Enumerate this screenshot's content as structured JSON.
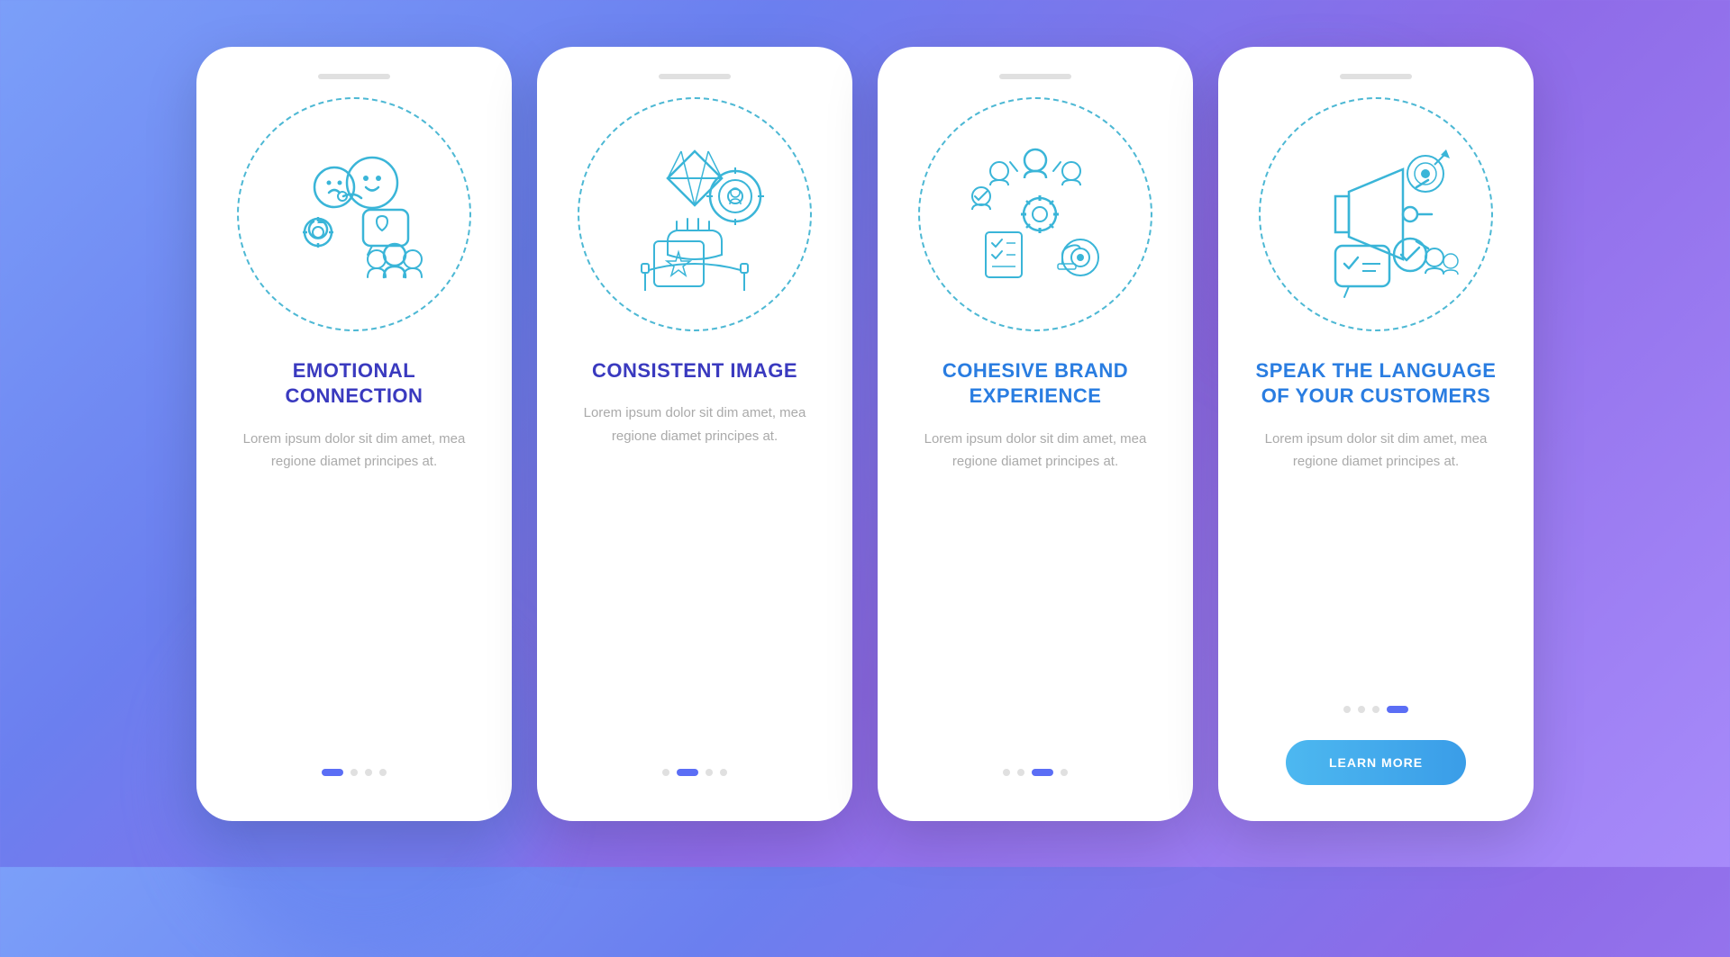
{
  "background": {
    "gradient_start": "#7b9ff9",
    "gradient_end": "#a78bfa"
  },
  "cards": [
    {
      "id": "card-1",
      "title": "EMOTIONAL\nCONNECTION",
      "description": "Lorem ipsum dolor sit dim amet, mea regione diamet principes at.",
      "dots": [
        "active",
        "inactive",
        "inactive",
        "inactive"
      ],
      "has_button": false
    },
    {
      "id": "card-2",
      "title": "CONSISTENT\nIMAGE",
      "description": "Lorem ipsum dolor sit dim amet, mea regione diamet principes at.",
      "dots": [
        "inactive",
        "active",
        "inactive",
        "inactive"
      ],
      "has_button": false
    },
    {
      "id": "card-3",
      "title": "COHESIVE BRAND\nEXPERIENCE",
      "description": "Lorem ipsum dolor sit dim amet, mea regione diamet principes at.",
      "dots": [
        "inactive",
        "inactive",
        "active",
        "inactive"
      ],
      "has_button": false
    },
    {
      "id": "card-4",
      "title": "SPEAK THE\nLANGUAGE OF\nYOUR CUSTOMERS",
      "description": "Lorem ipsum dolor sit dim amet, mea regione diamet principes at.",
      "dots": [
        "inactive",
        "inactive",
        "inactive",
        "active"
      ],
      "has_button": true,
      "button_label": "LEARN MORE"
    }
  ]
}
